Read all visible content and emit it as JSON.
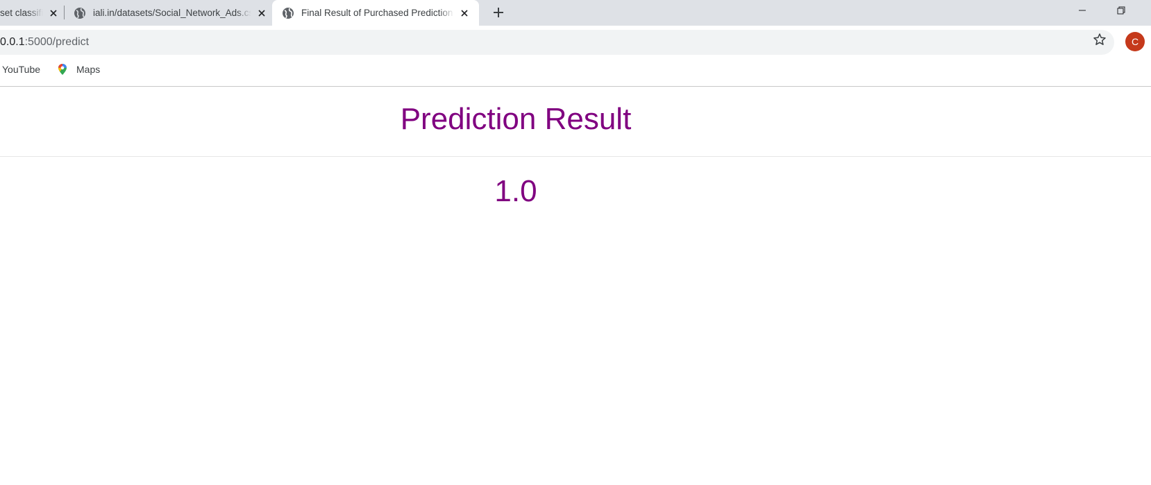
{
  "browser": {
    "tabs": [
      {
        "title": "set classific"
      },
      {
        "title": "iali.in/datasets/Social_Network_Ads.csv"
      },
      {
        "title": "Final Result of Purchased Prediction"
      }
    ],
    "active_tab": 2,
    "address_bar": {
      "host": "0.0.1",
      "path": ":5000/predict"
    },
    "profile_initial": "C",
    "bookmarks": [
      {
        "label": "YouTube",
        "icon": "youtube-icon"
      },
      {
        "label": "Maps",
        "icon": "maps-icon"
      }
    ]
  },
  "page": {
    "title": "Prediction Result",
    "result": "1.0"
  },
  "colors": {
    "accent_purple": "#800080",
    "tabstrip_bg": "#dee1e6",
    "omnibox_bg": "#f1f3f4",
    "avatar_bg": "#c5391b"
  }
}
